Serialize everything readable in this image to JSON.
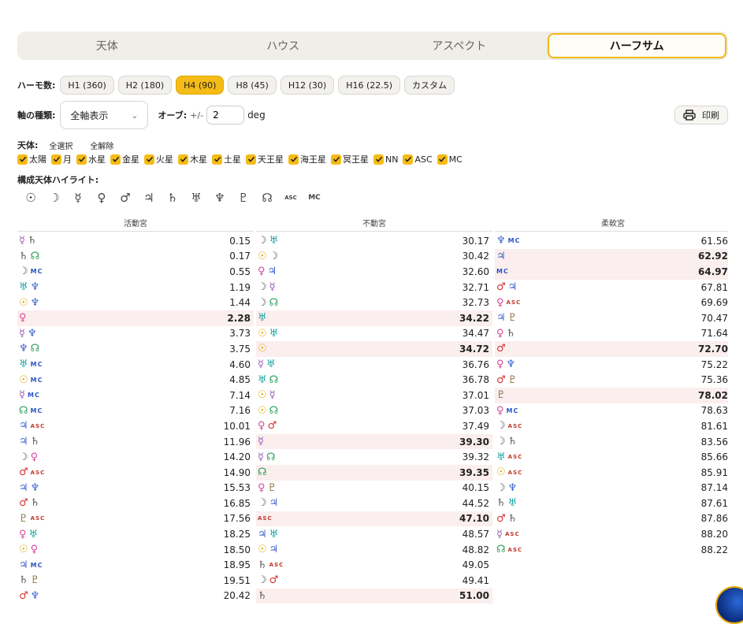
{
  "tabs": [
    {
      "label": "天体",
      "active": false
    },
    {
      "label": "ハウス",
      "active": false
    },
    {
      "label": "アスペクト",
      "active": false
    },
    {
      "label": "ハーフサム",
      "active": true
    }
  ],
  "harmonic": {
    "label": "ハーモ数:",
    "buttons": [
      {
        "label": "H1 (360)",
        "active": false
      },
      {
        "label": "H2 (180)",
        "active": false
      },
      {
        "label": "H4 (90)",
        "active": true
      },
      {
        "label": "H8 (45)",
        "active": false
      },
      {
        "label": "H12 (30)",
        "active": false
      },
      {
        "label": "H16 (22.5)",
        "active": false
      },
      {
        "label": "カスタム",
        "active": false
      }
    ]
  },
  "axis": {
    "label": "軸の種類:",
    "selected": "全軸表示"
  },
  "orb": {
    "label": "オーブ:",
    "unit_prefix": "+/-",
    "value": "2",
    "unit": "deg"
  },
  "print": {
    "label": "印刷"
  },
  "bodies": {
    "label": "天体:",
    "select_all": "全選択",
    "clear_all": "全解除",
    "items": [
      "太陽",
      "月",
      "水星",
      "金星",
      "火星",
      "木星",
      "土星",
      "天王星",
      "海王星",
      "冥王星",
      "NN",
      "ASC",
      "MC"
    ]
  },
  "highlight": {
    "label": "構成天体ハイライト:",
    "glyphs": [
      {
        "key": "sun",
        "sym": "☉"
      },
      {
        "key": "moon",
        "sym": "☽"
      },
      {
        "key": "mercury",
        "sym": "☿"
      },
      {
        "key": "venus",
        "sym": "♀"
      },
      {
        "key": "mars",
        "sym": "♂"
      },
      {
        "key": "jupiter",
        "sym": "♃"
      },
      {
        "key": "saturn",
        "sym": "♄"
      },
      {
        "key": "uranus",
        "sym": "♅"
      },
      {
        "key": "neptune",
        "sym": "♆"
      },
      {
        "key": "pluto",
        "sym": "♇"
      },
      {
        "key": "node",
        "sym": "☊"
      },
      {
        "key": "asc",
        "sym": "ASC"
      },
      {
        "key": "mc",
        "sym": "MC"
      }
    ]
  },
  "colors": {
    "sun": "#e0a800",
    "moon": "#555555",
    "mercury": "#9b59b6",
    "venus": "#d6479b",
    "mars": "#d32f2f",
    "jupiter": "#3a5fcd",
    "saturn": "#555555",
    "uranus": "#1aa3a3",
    "neptune": "#3a5fcd",
    "pluto": "#8a6d3b",
    "node": "#2e9e5b",
    "asc": "#c0392b",
    "mc": "#2a55c8"
  },
  "columns": [
    {
      "title": "活動宮",
      "rows": [
        {
          "a": "mercury",
          "b": "saturn",
          "v": "0.15",
          "hl": false
        },
        {
          "a": "saturn",
          "b": "node",
          "v": "0.17",
          "hl": false
        },
        {
          "a": "moon",
          "b": "mc",
          "v": "0.55",
          "hl": false
        },
        {
          "a": "uranus",
          "b": "neptune",
          "v": "1.19",
          "hl": false
        },
        {
          "a": "sun",
          "b": "neptune",
          "v": "1.44",
          "hl": false
        },
        {
          "a": "venus",
          "b": "",
          "v": "2.28",
          "hl": true
        },
        {
          "a": "mercury",
          "b": "neptune",
          "v": "3.73",
          "hl": false
        },
        {
          "a": "neptune",
          "b": "node",
          "v": "3.75",
          "hl": false
        },
        {
          "a": "uranus",
          "b": "mc",
          "v": "4.60",
          "hl": false
        },
        {
          "a": "sun",
          "b": "mc",
          "v": "4.85",
          "hl": false
        },
        {
          "a": "mercury",
          "b": "mc",
          "v": "7.14",
          "hl": false
        },
        {
          "a": "node",
          "b": "mc",
          "v": "7.16",
          "hl": false
        },
        {
          "a": "jupiter",
          "b": "asc",
          "v": "10.01",
          "hl": false
        },
        {
          "a": "jupiter",
          "b": "saturn",
          "v": "11.96",
          "hl": false
        },
        {
          "a": "moon",
          "b": "venus",
          "v": "14.20",
          "hl": false
        },
        {
          "a": "mars",
          "b": "asc",
          "v": "14.90",
          "hl": false
        },
        {
          "a": "jupiter",
          "b": "neptune",
          "v": "15.53",
          "hl": false
        },
        {
          "a": "mars",
          "b": "saturn",
          "v": "16.85",
          "hl": false
        },
        {
          "a": "pluto",
          "b": "asc",
          "v": "17.56",
          "hl": false
        },
        {
          "a": "venus",
          "b": "uranus",
          "v": "18.25",
          "hl": false
        },
        {
          "a": "sun",
          "b": "venus",
          "v": "18.50",
          "hl": false
        },
        {
          "a": "jupiter",
          "b": "mc",
          "v": "18.95",
          "hl": false
        },
        {
          "a": "saturn",
          "b": "pluto",
          "v": "19.51",
          "hl": false
        },
        {
          "a": "mars",
          "b": "neptune",
          "v": "20.42",
          "hl": false
        }
      ]
    },
    {
      "title": "不動宮",
      "rows": [
        {
          "a": "moon",
          "b": "uranus",
          "v": "30.17",
          "hl": false
        },
        {
          "a": "sun",
          "b": "moon",
          "v": "30.42",
          "hl": false
        },
        {
          "a": "venus",
          "b": "jupiter",
          "v": "32.60",
          "hl": false
        },
        {
          "a": "moon",
          "b": "mercury",
          "v": "32.71",
          "hl": false
        },
        {
          "a": "moon",
          "b": "node",
          "v": "32.73",
          "hl": false
        },
        {
          "a": "uranus",
          "b": "",
          "v": "34.22",
          "hl": true
        },
        {
          "a": "sun",
          "b": "uranus",
          "v": "34.47",
          "hl": false
        },
        {
          "a": "sun",
          "b": "",
          "v": "34.72",
          "hl": true
        },
        {
          "a": "mercury",
          "b": "uranus",
          "v": "36.76",
          "hl": false
        },
        {
          "a": "uranus",
          "b": "node",
          "v": "36.78",
          "hl": false
        },
        {
          "a": "sun",
          "b": "mercury",
          "v": "37.01",
          "hl": false
        },
        {
          "a": "sun",
          "b": "node",
          "v": "37.03",
          "hl": false
        },
        {
          "a": "venus",
          "b": "mars",
          "v": "37.49",
          "hl": false
        },
        {
          "a": "mercury",
          "b": "",
          "v": "39.30",
          "hl": true
        },
        {
          "a": "mercury",
          "b": "node",
          "v": "39.32",
          "hl": false
        },
        {
          "a": "node",
          "b": "",
          "v": "39.35",
          "hl": true
        },
        {
          "a": "venus",
          "b": "pluto",
          "v": "40.15",
          "hl": false
        },
        {
          "a": "moon",
          "b": "jupiter",
          "v": "44.52",
          "hl": false
        },
        {
          "a": "asc",
          "b": "",
          "v": "47.10",
          "hl": true
        },
        {
          "a": "jupiter",
          "b": "uranus",
          "v": "48.57",
          "hl": false
        },
        {
          "a": "sun",
          "b": "jupiter",
          "v": "48.82",
          "hl": false
        },
        {
          "a": "saturn",
          "b": "asc",
          "v": "49.05",
          "hl": false
        },
        {
          "a": "moon",
          "b": "mars",
          "v": "49.41",
          "hl": false
        },
        {
          "a": "saturn",
          "b": "",
          "v": "51.00",
          "hl": true
        }
      ]
    },
    {
      "title": "柔軟宮",
      "rows": [
        {
          "a": "neptune",
          "b": "mc",
          "v": "61.56",
          "hl": false
        },
        {
          "a": "jupiter",
          "b": "",
          "v": "62.92",
          "hl": true
        },
        {
          "a": "mc",
          "b": "",
          "v": "64.97",
          "hl": true
        },
        {
          "a": "mars",
          "b": "jupiter",
          "v": "67.81",
          "hl": false
        },
        {
          "a": "venus",
          "b": "asc",
          "v": "69.69",
          "hl": false
        },
        {
          "a": "jupiter",
          "b": "pluto",
          "v": "70.47",
          "hl": false
        },
        {
          "a": "venus",
          "b": "saturn",
          "v": "71.64",
          "hl": false
        },
        {
          "a": "mars",
          "b": "",
          "v": "72.70",
          "hl": true
        },
        {
          "a": "venus",
          "b": "neptune",
          "v": "75.22",
          "hl": false
        },
        {
          "a": "mars",
          "b": "pluto",
          "v": "75.36",
          "hl": false
        },
        {
          "a": "pluto",
          "b": "",
          "v": "78.02",
          "hl": true
        },
        {
          "a": "venus",
          "b": "mc",
          "v": "78.63",
          "hl": false
        },
        {
          "a": "moon",
          "b": "asc",
          "v": "81.61",
          "hl": false
        },
        {
          "a": "moon",
          "b": "saturn",
          "v": "83.56",
          "hl": false
        },
        {
          "a": "uranus",
          "b": "asc",
          "v": "85.66",
          "hl": false
        },
        {
          "a": "sun",
          "b": "asc",
          "v": "85.91",
          "hl": false
        },
        {
          "a": "moon",
          "b": "neptune",
          "v": "87.14",
          "hl": false
        },
        {
          "a": "saturn",
          "b": "uranus",
          "v": "87.61",
          "hl": false
        },
        {
          "a": "mars",
          "b": "saturn",
          "v": "87.86",
          "hl": false
        },
        {
          "a": "mercury",
          "b": "asc",
          "v": "88.20",
          "hl": false
        },
        {
          "a": "node",
          "b": "asc",
          "v": "88.22",
          "hl": false
        }
      ]
    }
  ]
}
